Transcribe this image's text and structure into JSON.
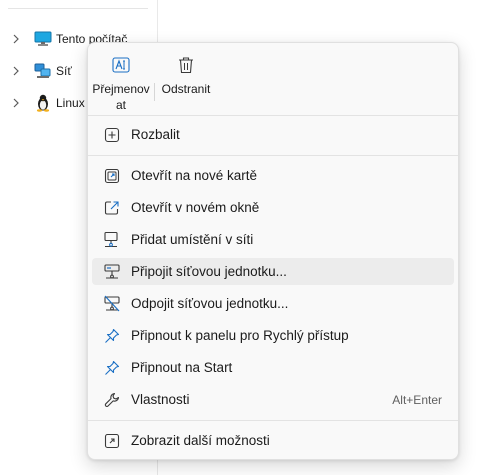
{
  "nav": {
    "items": [
      {
        "label": "Tento počítač",
        "icon": "monitor-icon"
      },
      {
        "label": "Síť",
        "icon": "network-icon"
      },
      {
        "label": "Linux",
        "icon": "linux-penguin-icon"
      }
    ]
  },
  "context_menu": {
    "quick_actions": [
      {
        "label": "Přejmenovat",
        "icon": "rename-icon"
      },
      {
        "label": "Odstranit",
        "icon": "trash-icon"
      }
    ],
    "items": [
      {
        "label": "Rozbalit",
        "icon": "expand-icon"
      },
      {
        "label": "Otevřít na nové kartě",
        "icon": "new-tab-icon"
      },
      {
        "label": "Otevřít v novém okně",
        "icon": "new-window-icon"
      },
      {
        "label": "Přidat umístění v síti",
        "icon": "add-network-location-icon"
      },
      {
        "label": "Připojit síťovou jednotku...",
        "icon": "map-network-drive-icon"
      },
      {
        "label": "Odpojit síťovou jednotku...",
        "icon": "disconnect-network-drive-icon"
      },
      {
        "label": "Připnout k panelu pro Rychlý přístup",
        "icon": "pin-icon"
      },
      {
        "label": "Připnout na Start",
        "icon": "pin-start-icon"
      },
      {
        "label": "Vlastnosti",
        "icon": "wrench-icon",
        "shortcut": "Alt+Enter"
      },
      {
        "label": "Zobrazit další možnosti",
        "icon": "more-options-icon"
      }
    ],
    "hovered_item": "Připojit síťovou jednotku...",
    "accent_color": "#1a6fc4"
  }
}
